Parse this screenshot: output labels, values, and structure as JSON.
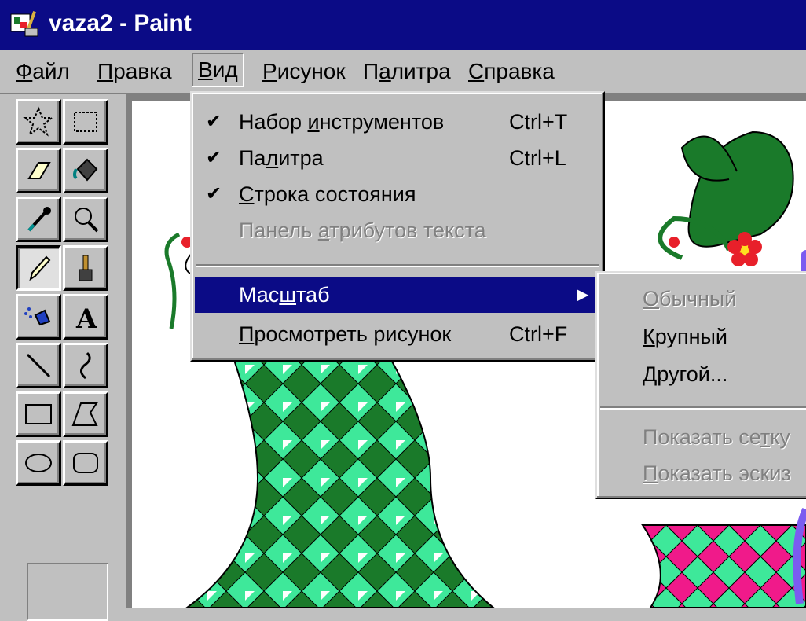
{
  "window": {
    "title": "vaza2 - Paint"
  },
  "menubar": {
    "items": [
      {
        "label": "Файл",
        "ul": "Ф",
        "rest": "айл"
      },
      {
        "label": "Правка",
        "ul": "П",
        "rest": "равка"
      },
      {
        "label": "Вид",
        "ul": "В",
        "rest": "ид"
      },
      {
        "label": "Рисунок",
        "ul": "Р",
        "rest": "исунок"
      },
      {
        "label": "Палитра",
        "pre": "П",
        "ul": "а",
        "rest": "литра"
      },
      {
        "label": "Справка",
        "ul": "С",
        "rest": "правка"
      }
    ]
  },
  "view_menu": {
    "items": [
      {
        "pre": "Набор ",
        "ul": "и",
        "rest": "нструментов",
        "shortcut": "Ctrl+T",
        "checked": true
      },
      {
        "pre": "Па",
        "ul": "л",
        "rest": "итра",
        "shortcut": "Ctrl+L",
        "checked": true
      },
      {
        "pre": "",
        "ul": "С",
        "rest": "трока состояния",
        "shortcut": "",
        "checked": true
      },
      {
        "pre": "Панель ",
        "ul": "а",
        "rest": "трибутов текста",
        "shortcut": "",
        "checked": false,
        "disabled": true
      },
      {
        "pre": "Мас",
        "ul": "ш",
        "rest": "таб",
        "shortcut": "",
        "submenu": true,
        "selected": true
      },
      {
        "pre": "",
        "ul": "П",
        "rest": "росмотреть рисунок",
        "shortcut": "Ctrl+F"
      }
    ],
    "check_glyph": "✔",
    "arrow_glyph": "▶"
  },
  "zoom_submenu": {
    "items": [
      {
        "pre": "",
        "ul": "О",
        "rest": "бычный",
        "disabled": true
      },
      {
        "pre": "",
        "ul": "К",
        "rest": "рупный"
      },
      {
        "pre": "",
        "ul": "Д",
        "rest": "ругой..."
      },
      {
        "pre": "Показать се",
        "ul": "т",
        "rest": "ку",
        "disabled": true
      },
      {
        "pre": "",
        "ul": "П",
        "rest": "оказать эскиз",
        "disabled": true
      }
    ]
  },
  "toolbox": {
    "tools": [
      "free-select",
      "rect-select",
      "eraser",
      "fill",
      "color-picker",
      "magnifier",
      "pencil",
      "brush",
      "airbrush",
      "text",
      "line",
      "curve",
      "rectangle",
      "polygon",
      "ellipse",
      "rounded-rect"
    ],
    "text_tool_glyph": "A",
    "pressed": "pencil"
  },
  "colors": {
    "title_bg": "#0b0b86",
    "chrome": "#c0c0c0",
    "vase_dark": "#1a7a2a",
    "vase_light": "#3ee89a",
    "vase_pink": "#f01a8a",
    "flower_red": "#e8202a",
    "overlay_purple": "#7b5cf0"
  }
}
